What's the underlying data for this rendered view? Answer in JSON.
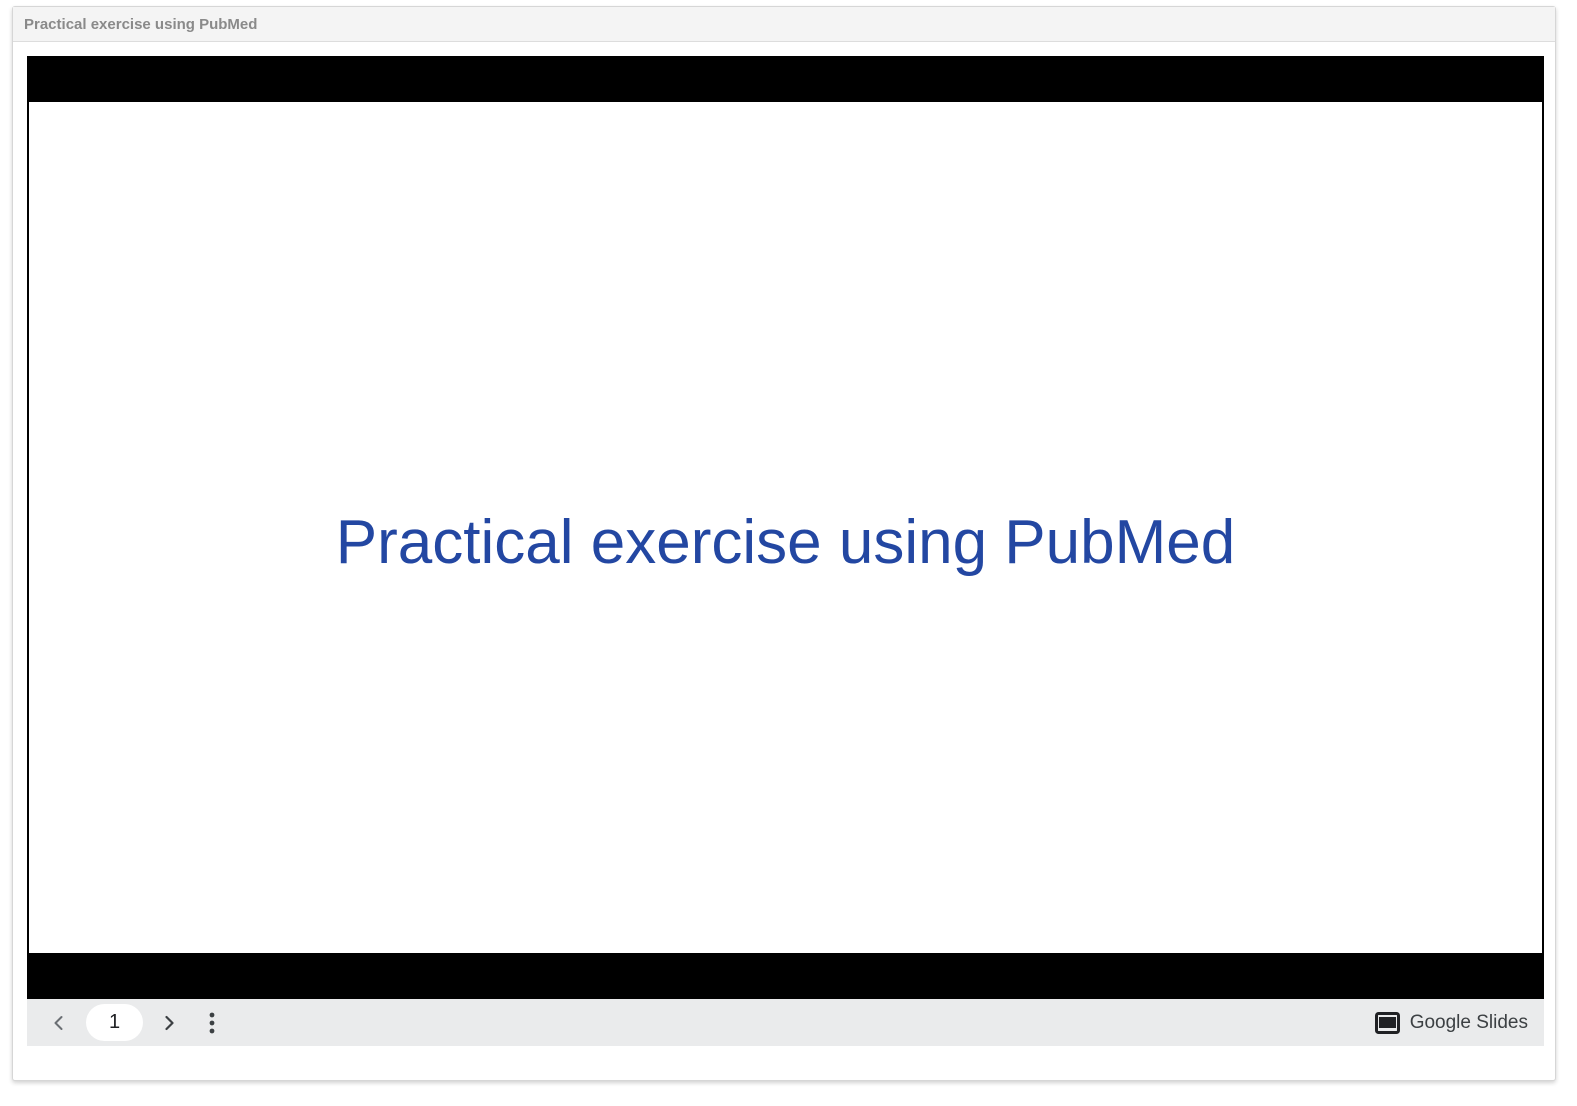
{
  "card": {
    "title": "Practical exercise using PubMed"
  },
  "slide": {
    "title": "Practical exercise using PubMed",
    "title_color": "#2347a2"
  },
  "toolbar": {
    "prev_icon": "chevron-left-icon",
    "next_icon": "chevron-right-icon",
    "more_icon": "more-vert-icon",
    "page_number": "1",
    "brand_icon": "slides-icon",
    "brand_label": "Google Slides"
  }
}
